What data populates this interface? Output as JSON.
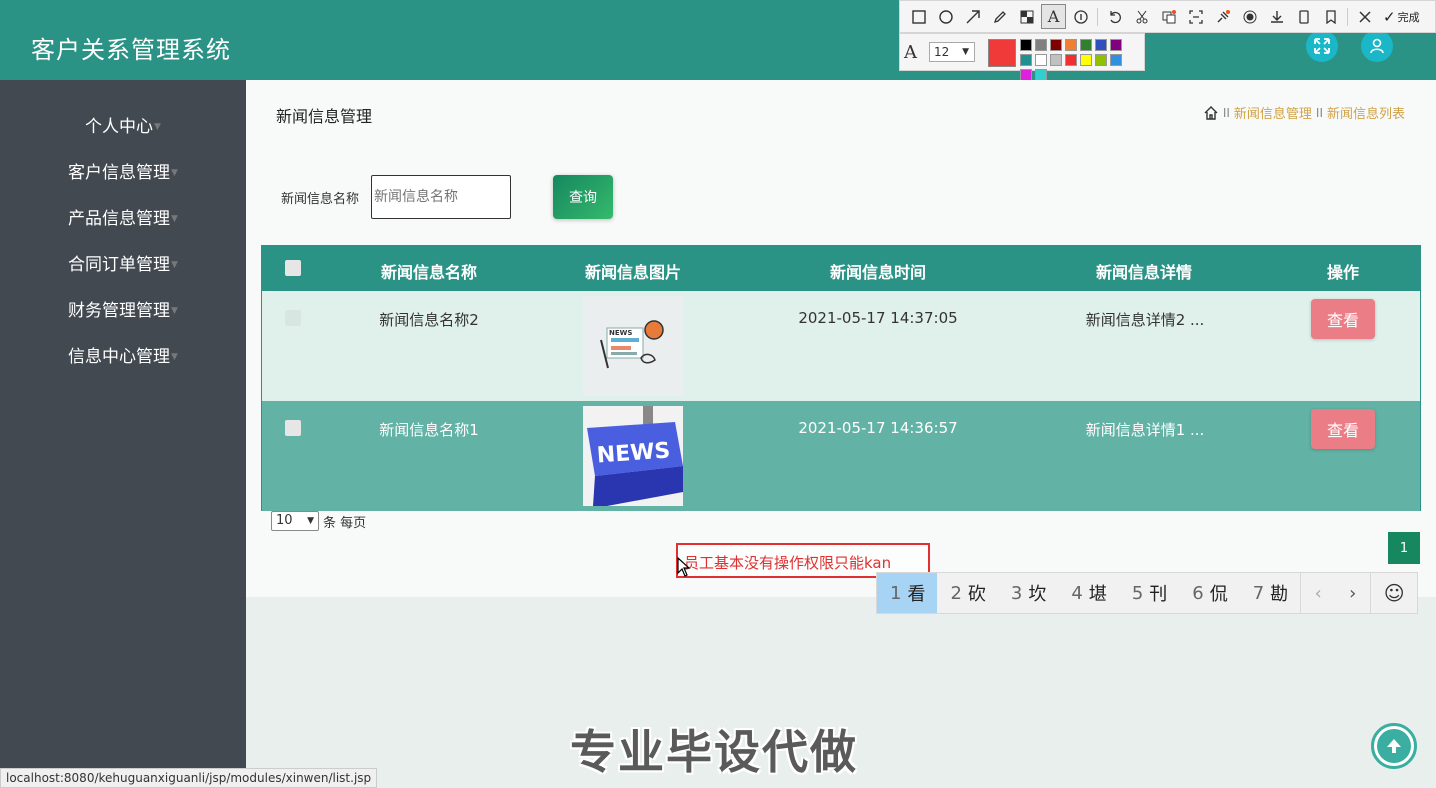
{
  "app": {
    "title": "客户关系管理系统"
  },
  "screenshot_toolbar": {
    "done_label": "完成",
    "font_size": "12",
    "current_color": "#f03a3a",
    "palette": [
      "#000000",
      "#808080",
      "#800000",
      "#f08030",
      "#308030",
      "#3050c0",
      "#800080",
      "#209090",
      "#ffffff",
      "#c0c0c0",
      "#f03030",
      "#ffff00",
      "#90c000",
      "#3090e0",
      "#e020e0",
      "#30d0d0"
    ]
  },
  "sidebar": {
    "items": [
      {
        "label": "个人中心"
      },
      {
        "label": "客户信息管理"
      },
      {
        "label": "产品信息管理"
      },
      {
        "label": "合同订单管理"
      },
      {
        "label": "财务管理管理"
      },
      {
        "label": "信息中心管理"
      }
    ]
  },
  "page": {
    "title": "新闻信息管理",
    "breadcrumb": [
      "新闻信息管理",
      "新闻信息列表"
    ],
    "breadcrumb_sep": "II"
  },
  "search": {
    "label": "新闻信息名称",
    "placeholder": "新闻信息名称",
    "button": "查询"
  },
  "table": {
    "columns": [
      "新闻信息名称",
      "新闻信息图片",
      "新闻信息时间",
      "新闻信息详情",
      "操作"
    ],
    "rows": [
      {
        "name": "新闻信息名称2",
        "time": "2021-05-17 14:37:05",
        "detail": "新闻信息详情2 ...",
        "action": "查看"
      },
      {
        "name": "新闻信息名称1",
        "time": "2021-05-17 14:36:57",
        "detail": "新闻信息详情1 ...",
        "action": "查看"
      }
    ],
    "thumb_text": "NEWS"
  },
  "pagination": {
    "page_size": "10",
    "page_size_suffix": "条 每页",
    "current_page": "1"
  },
  "annotation": {
    "text": "员工基本没有操作权限只能kan"
  },
  "ime": {
    "candidates": [
      {
        "n": "1",
        "c": "看"
      },
      {
        "n": "2",
        "c": "砍"
      },
      {
        "n": "3",
        "c": "坎"
      },
      {
        "n": "4",
        "c": "堪"
      },
      {
        "n": "5",
        "c": "刊"
      },
      {
        "n": "6",
        "c": "侃"
      },
      {
        "n": "7",
        "c": "勘"
      }
    ]
  },
  "watermark": "专业毕设代做",
  "status_url": "localhost:8080/kehuguanxiguanli/jsp/modules/xinwen/list.jsp",
  "colors": {
    "header": "#2a9385",
    "sidebar": "#424950",
    "accent_green": "#16875f",
    "view_button": "#ea7d86",
    "breadcrumb": "#d0a247"
  }
}
